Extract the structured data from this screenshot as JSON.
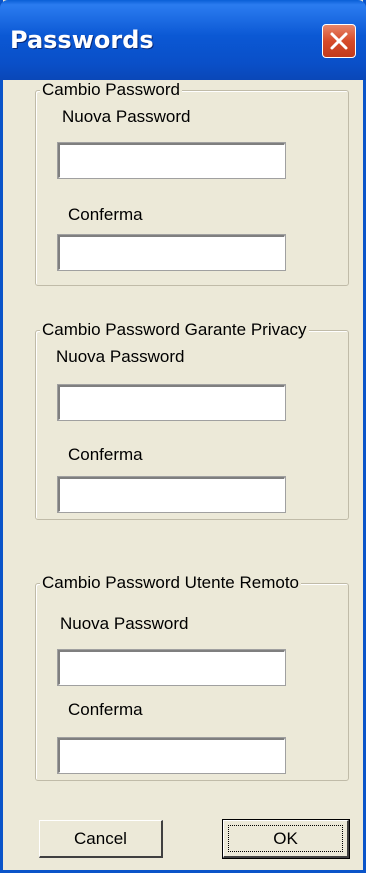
{
  "window": {
    "title": "Passwords",
    "close_icon": "close-icon"
  },
  "groups": [
    {
      "legend": "Cambio Password",
      "new_label": "Nuova Password",
      "new_value": "",
      "confirm_label": "Conferma",
      "confirm_value": ""
    },
    {
      "legend": "Cambio Password Garante Privacy",
      "new_label": "Nuova Password",
      "new_value": "",
      "confirm_label": "Conferma",
      "confirm_value": ""
    },
    {
      "legend": "Cambio Password Utente Remoto",
      "new_label": "Nuova Password",
      "new_value": "",
      "confirm_label": "Conferma",
      "confirm_value": ""
    }
  ],
  "buttons": {
    "cancel_label": "Cancel",
    "ok_label": "OK"
  },
  "colors": {
    "titlebar": "#0a58d4",
    "dialog_bg": "#ece9d8",
    "close_button": "#d64b2a"
  }
}
